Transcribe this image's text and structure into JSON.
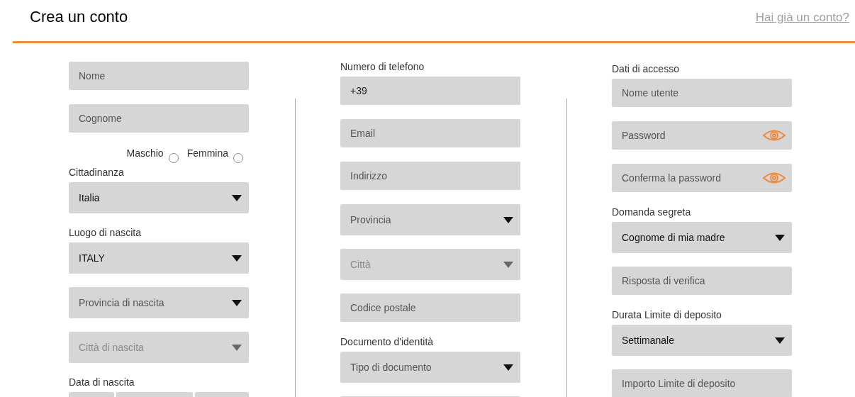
{
  "header": {
    "title": "Crea un conto",
    "login_link": "Hai già un conto?"
  },
  "columns": [
    {
      "items": [
        {
          "kind": "input",
          "placeholder": "Nome"
        },
        {
          "kind": "input",
          "placeholder": "Cognome"
        },
        {
          "kind": "radios",
          "options": [
            {
              "label": "Maschio",
              "selected": false
            },
            {
              "label": "Femmina",
              "selected": false
            }
          ]
        },
        {
          "kind": "label",
          "text": "Cittadinanza"
        },
        {
          "kind": "select",
          "value": "Italia",
          "disabled": false
        },
        {
          "kind": "label",
          "text": "Luogo di nascita"
        },
        {
          "kind": "select",
          "value": "ITALY",
          "disabled": false
        },
        {
          "kind": "select",
          "placeholder": "Provincia di nascita",
          "disabled": false
        },
        {
          "kind": "select",
          "placeholder": "Città di nascita",
          "disabled": true
        },
        {
          "kind": "label",
          "text": "Data di nascita"
        },
        {
          "kind": "date"
        }
      ]
    },
    {
      "items": [
        {
          "kind": "label",
          "text": "Numero di telefono"
        },
        {
          "kind": "input",
          "value": "+39"
        },
        {
          "kind": "input",
          "placeholder": "Email"
        },
        {
          "kind": "input",
          "placeholder": "Indirizzo"
        },
        {
          "kind": "select",
          "placeholder": "Provincia",
          "disabled": false
        },
        {
          "kind": "select",
          "placeholder": "Città",
          "disabled": true
        },
        {
          "kind": "input",
          "placeholder": "Codice postale"
        },
        {
          "kind": "label",
          "text": "Documento d'identità"
        },
        {
          "kind": "select",
          "placeholder": "Tipo di documento",
          "disabled": false
        },
        {
          "kind": "input"
        }
      ]
    },
    {
      "items": [
        {
          "kind": "label",
          "text": "Dati di accesso"
        },
        {
          "kind": "input",
          "placeholder": "Nome utente"
        },
        {
          "kind": "password",
          "placeholder": "Password"
        },
        {
          "kind": "password",
          "placeholder": "Conferma la password"
        },
        {
          "kind": "label",
          "text": "Domanda segreta"
        },
        {
          "kind": "select",
          "value": "Cognome di mia madre",
          "disabled": false
        },
        {
          "kind": "input",
          "placeholder": "Risposta di verifica"
        },
        {
          "kind": "label",
          "text": "Durata Limite di deposito"
        },
        {
          "kind": "select",
          "value": "Settimanale",
          "disabled": false
        },
        {
          "kind": "input",
          "placeholder": "Importo Limite di deposito"
        }
      ]
    }
  ]
}
